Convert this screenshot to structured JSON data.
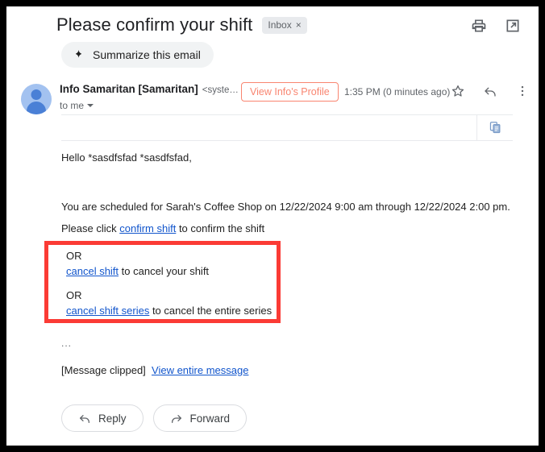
{
  "header": {
    "subject": "Please confirm your shift",
    "label_chip": "Inbox",
    "label_chip_close": "×",
    "print_icon": "print-icon",
    "open_in_new_icon": "open-in-new-window-icon"
  },
  "summarize": {
    "label": "Summarize this email",
    "icon": "sparkle-icon"
  },
  "sender": {
    "avatar_icon": "default-user-avatar",
    "name": "Info Samaritan [Samaritan]",
    "email": "<syste…",
    "recipient": "to me",
    "details_caret_icon": "chevron-down-icon",
    "profile_button": "View Info's Profile",
    "profile_button_color": "#f98570",
    "timestamp": "1:35 PM (0 minutes ago)",
    "star_icon": "star-icon",
    "reply_icon": "reply-arrow-icon",
    "more_icon": "more-vertical-icon"
  },
  "table_strip": {
    "copy_icon": "copy-duplicate-icon",
    "copy_icon_color": "#7a9bc8"
  },
  "body": {
    "greeting": "Hello *sasdfsfad *sasdfsfad,",
    "scheduled": "You are scheduled for Sarah's Coffee Shop on 12/22/2024 9:00 am through 12/22/2024 2:00 pm.",
    "confirm_prefix": "Please click ",
    "confirm_link": "confirm shift",
    "confirm_suffix": " to confirm the shift",
    "ellipsis": "...",
    "clipped_label": "[Message clipped]",
    "view_entire_message": "View entire message",
    "link_color": "#1155cc"
  },
  "annotation": {
    "box_color": "#fb3b35",
    "or_1": "OR",
    "cancel_link": "cancel shift",
    "cancel_suffix": " to cancel your shift",
    "or_2": "OR",
    "cancel_series_link": "cancel shift series",
    "cancel_series_suffix": " to cancel the entire series"
  },
  "actions": {
    "reply_label": "Reply",
    "reply_icon": "reply-arrow-icon",
    "forward_label": "Forward",
    "forward_icon": "forward-arrow-icon"
  }
}
